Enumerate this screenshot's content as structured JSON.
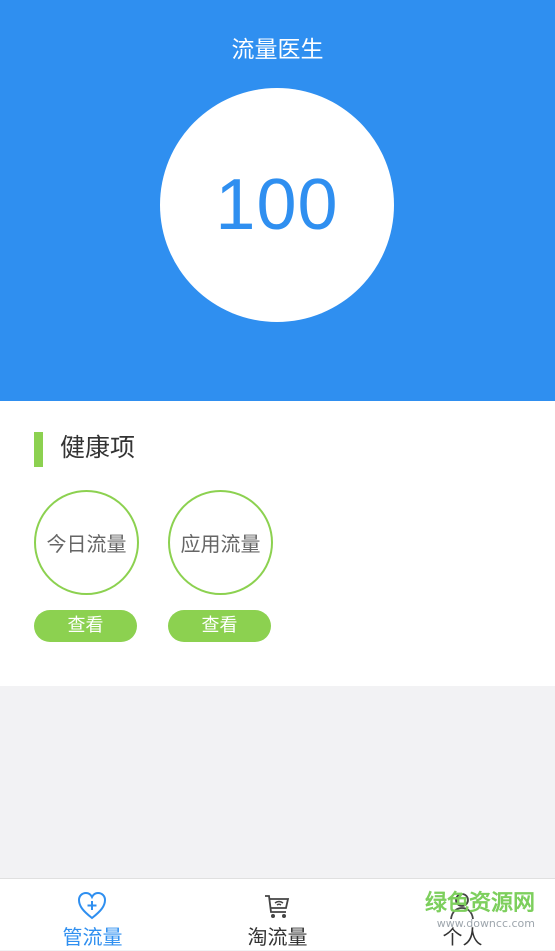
{
  "header": {
    "title": "流量医生",
    "score": "100"
  },
  "health": {
    "title": "健康项",
    "items": [
      {
        "label": "今日流量",
        "button_label": "查看"
      },
      {
        "label": "应用流量",
        "button_label": "查看"
      }
    ]
  },
  "tabs": [
    {
      "label": "管流量",
      "icon": "heart-plus-icon",
      "active": true
    },
    {
      "label": "淘流量",
      "icon": "cart-wifi-icon",
      "active": false
    },
    {
      "label": "个人",
      "icon": "person-icon",
      "active": false
    }
  ],
  "watermark": {
    "text": "绿色资源网",
    "url": "www.downcc.com"
  },
  "colors": {
    "primary": "#2f8ff0",
    "accent": "#8cd150",
    "tab_active": "#2f8ff0",
    "tab_inactive": "#333333"
  }
}
